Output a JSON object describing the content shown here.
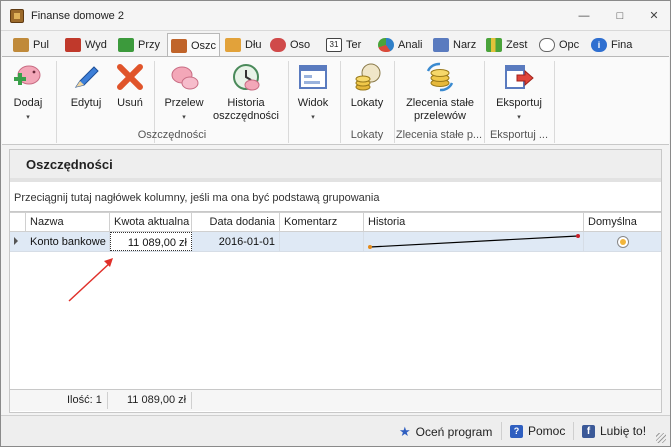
{
  "window": {
    "title": "Finanse domowe 2",
    "controls": {
      "minimize": "—",
      "restore": "□",
      "close": "✕"
    }
  },
  "tabs": [
    {
      "label": "Pul",
      "icon": "wallet-icon",
      "color": "#c08a3a",
      "active": false
    },
    {
      "label": "Wyd",
      "icon": "expenses-icon",
      "color": "#c0392b",
      "active": false
    },
    {
      "label": "Przy",
      "icon": "income-icon",
      "color": "#3c9a3c",
      "active": false
    },
    {
      "label": "Oszc",
      "icon": "savings-icon",
      "color": "#c0642a",
      "active": true
    },
    {
      "label": "Dłu",
      "icon": "debts-icon",
      "color": "#e2a23a",
      "active": false
    },
    {
      "label": "Oso",
      "icon": "people-icon",
      "color": "#d04a4a",
      "active": false
    },
    {
      "label": "Ter",
      "icon": "calendar-icon",
      "color": "#444444",
      "active": false
    },
    {
      "label": "Anali",
      "icon": "pie-chart-icon",
      "color": "#2f7fc8",
      "active": false
    },
    {
      "label": "Narz",
      "icon": "tools-icon",
      "color": "#5a7bbf",
      "active": false
    },
    {
      "label": "Zest",
      "icon": "report-icon",
      "color": "#4aa33a",
      "active": false
    },
    {
      "label": "Opc",
      "icon": "options-icon",
      "color": "#666666",
      "active": false
    },
    {
      "label": "Fina",
      "icon": "info-icon",
      "color": "#2f6fd0",
      "active": false
    }
  ],
  "ribbon": {
    "buttons": {
      "add": "Dodaj",
      "edit": "Edytuj",
      "delete": "Usuń",
      "transfer": "Przelew",
      "history_line1": "Historia",
      "history_line2": "oszczędności",
      "view": "Widok",
      "deposits": "Lokaty",
      "standing_line1": "Zlecenia stałe",
      "standing_line2": "przelewów",
      "export": "Eksportuj"
    },
    "groups": {
      "savings": "Oszczędności",
      "deposits": "Lokaty",
      "standing": "Zlecenia stałe p...",
      "export": "Eksportuj ..."
    },
    "caret": "▾"
  },
  "pane": {
    "title": "Oszczędności",
    "group_hint": "Przeciągnij tutaj nagłówek kolumny, jeśli ma ona być podstawą grupowania"
  },
  "grid": {
    "columns": [
      "Nazwa",
      "Kwota aktualna",
      "Data dodania",
      "Komentarz",
      "Historia",
      "Domyślna"
    ],
    "rows": [
      {
        "name": "Konto bankowe",
        "amount": "11 089,00 zł",
        "date": "2016-01-01",
        "comment": "",
        "default_radio": true
      }
    ],
    "footer": {
      "count_label": "Ilość: 1",
      "sum": "11 089,00 zł"
    }
  },
  "statusbar": {
    "rate": "Oceń program",
    "help": "Pomoc",
    "like": "Lubię to!"
  }
}
